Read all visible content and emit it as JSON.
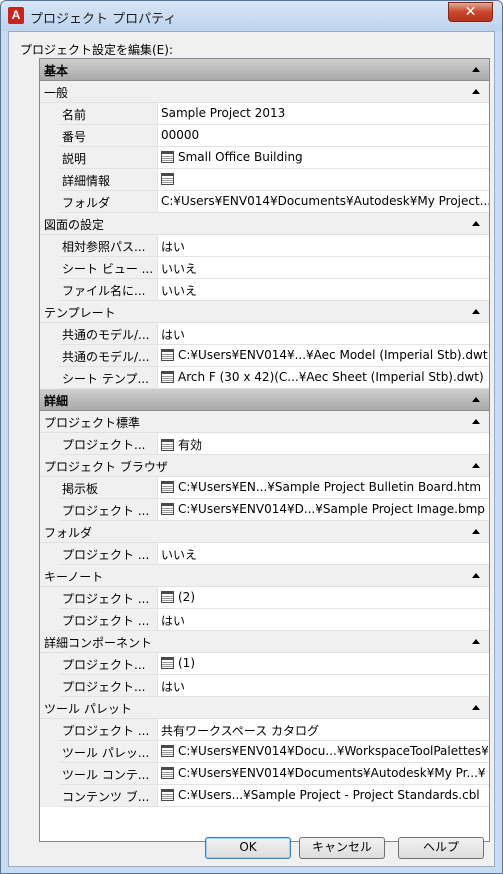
{
  "window": {
    "title": "プロジェクト プロパティ",
    "close_label": "✕",
    "app_icon_letter": "A"
  },
  "edit_label": "プロジェクト設定を編集(E):",
  "groups": [
    {
      "label": "基本",
      "subs": [
        {
          "label": "一般",
          "props": [
            {
              "name": "名前",
              "value": "Sample Project 2013",
              "icon": false
            },
            {
              "name": "番号",
              "value": "00000",
              "icon": false
            },
            {
              "name": "説明",
              "value": "Small Office Building",
              "icon": true
            },
            {
              "name": "詳細情報",
              "value": "",
              "icon": true
            },
            {
              "name": "フォルダ",
              "value": "C:¥Users¥ENV014¥Documents¥Autodesk¥My Project...",
              "icon": false
            }
          ]
        },
        {
          "label": "図面の設定",
          "props": [
            {
              "name": "相対参照パス...",
              "value": "はい",
              "icon": false
            },
            {
              "name": "シート ビュー ...",
              "value": "いいえ",
              "icon": false
            },
            {
              "name": "ファイル名に...",
              "value": "いいえ",
              "icon": false
            }
          ]
        },
        {
          "label": "テンプレート",
          "props": [
            {
              "name": "共通のモデル/...",
              "value": "はい",
              "icon": false
            },
            {
              "name": "共通のモデル/...",
              "value": "C:¥Users¥ENV014¥...¥Aec Model (Imperial Stb).dwt",
              "icon": true
            },
            {
              "name": "シート テンプ...",
              "value": "Arch F (30 x 42)(C...¥Aec Sheet (Imperial Stb).dwt)",
              "icon": true
            }
          ]
        }
      ]
    },
    {
      "label": "詳細",
      "subs": [
        {
          "label": "プロジェクト標準",
          "props": [
            {
              "name": "プロジェクト...",
              "value": "有効",
              "icon": true
            }
          ]
        },
        {
          "label": "プロジェクト ブラウザ",
          "props": [
            {
              "name": "掲示板",
              "value": "C:¥Users¥EN...¥Sample Project Bulletin Board.htm",
              "icon": true
            },
            {
              "name": "プロジェクト ...",
              "value": "C:¥Users¥ENV014¥D...¥Sample Project Image.bmp",
              "icon": true
            }
          ]
        },
        {
          "label": "フォルダ",
          "props": [
            {
              "name": "プロジェクト ...",
              "value": "いいえ",
              "icon": false
            }
          ]
        },
        {
          "label": "キーノート",
          "props": [
            {
              "name": "プロジェクト ...",
              "value": "(2)",
              "icon": true
            },
            {
              "name": "プロジェクト ...",
              "value": "はい",
              "icon": false
            }
          ]
        },
        {
          "label": "詳細コンポーネント",
          "props": [
            {
              "name": "プロジェクト...",
              "value": "(1)",
              "icon": true
            },
            {
              "name": "プロジェクト...",
              "value": "はい",
              "icon": false
            }
          ]
        },
        {
          "label": "ツール パレット",
          "props": [
            {
              "name": "プロジェクト ...",
              "value": "共有ワークスペース カタログ",
              "icon": false
            },
            {
              "name": "ツール パレッ...",
              "value": "C:¥Users¥ENV014¥Docu...¥WorkspaceToolPalettes¥",
              "icon": true
            },
            {
              "name": "ツール コンテ...",
              "value": "C:¥Users¥ENV014¥Documents¥Autodesk¥My Pr...¥",
              "icon": true
            },
            {
              "name": "コンテンツ ブ...",
              "value": "C:¥Users...¥Sample Project - Project Standards.cbl",
              "icon": true
            }
          ]
        }
      ]
    }
  ],
  "buttons": {
    "ok": "OK",
    "cancel": "キャンセル",
    "help": "ヘルプ"
  }
}
